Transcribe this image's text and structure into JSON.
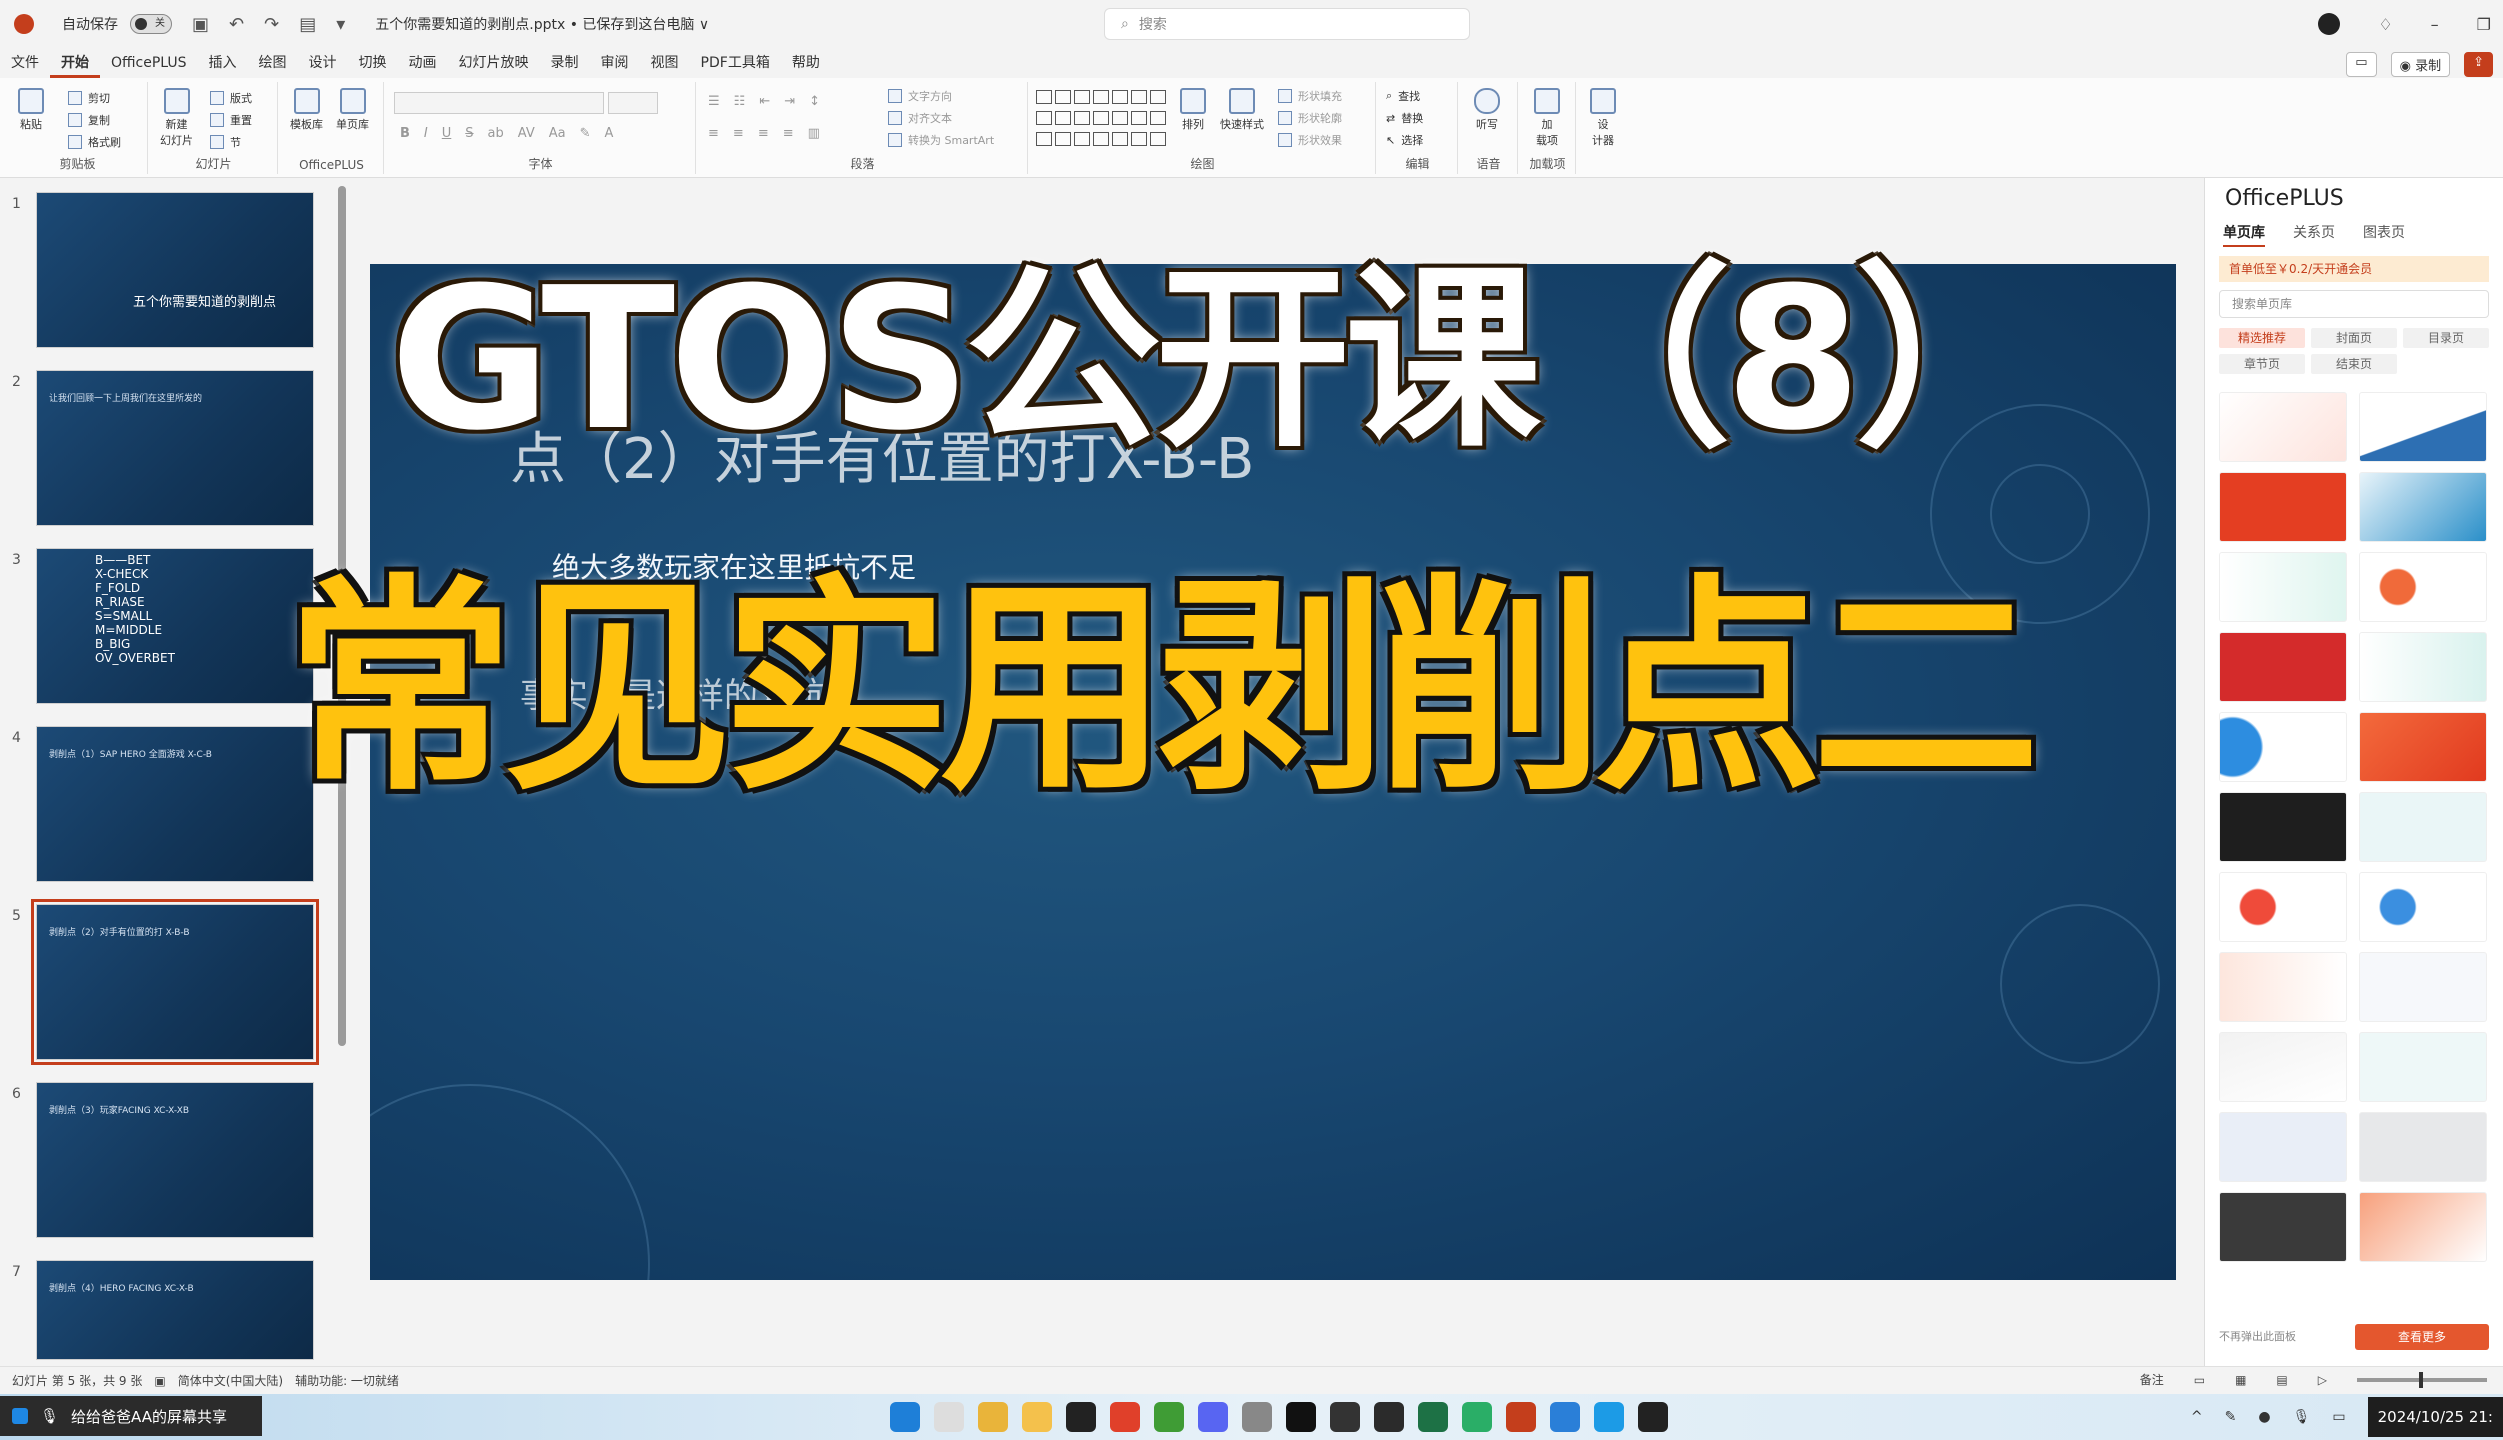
{
  "titlebar": {
    "autosave_label": "自动保存",
    "autosave_state": "关",
    "filename": "五个你需要知道的剥削点.pptx • 已保存到这台电脑 ∨",
    "search_placeholder": "搜索"
  },
  "menu": {
    "tabs": [
      "文件",
      "开始",
      "OfficePLUS",
      "插入",
      "绘图",
      "设计",
      "切换",
      "动画",
      "幻灯片放映",
      "录制",
      "审阅",
      "视图",
      "PDF工具箱",
      "帮助"
    ],
    "active": "开始",
    "record_label": "录制"
  },
  "ribbon": {
    "clipboard": {
      "paste": "粘贴",
      "cut": "剪切",
      "copy": "复制",
      "format_painter": "格式刷",
      "label": "剪贴板"
    },
    "slides": {
      "new_slide": "新建\n幻灯片",
      "layout": "版式",
      "reset": "重置",
      "section": "节",
      "label": "幻灯片"
    },
    "officeplus": {
      "template": "模板库",
      "single": "单页库",
      "label": "OfficePLUS"
    },
    "font": {
      "label": "字体"
    },
    "paragraph": {
      "text_direction": "文字方向",
      "align_text": "对齐文本",
      "smartart": "转换为 SmartArt",
      "label": "段落"
    },
    "drawing": {
      "arrange": "排列",
      "quick_styles": "快速样式",
      "shape_fill": "形状填充",
      "shape_outline": "形状轮廓",
      "shape_effects": "形状效果",
      "label": "绘图"
    },
    "editing": {
      "find": "查找",
      "replace": "替换",
      "select": "选择",
      "label": "编辑"
    },
    "voice": {
      "dictate": "听写",
      "label": "语音"
    },
    "addins": {
      "addins": "加\n载项",
      "label": "加载项"
    },
    "designer": {
      "designer": "设\n计器"
    }
  },
  "thumbnails": [
    {
      "num": "1",
      "title": "五个你需要知道的剥削点"
    },
    {
      "num": "2",
      "title": "让我们回顾一下上周我们在这里所发的"
    },
    {
      "num": "3",
      "list": "B——BET\nX-CHECK\nF_FOLD\nR_RIASE\nS=SMALL\nM=MIDDLE\nB_BIG\nOV_OVERBET"
    },
    {
      "num": "4",
      "title": "剥削点（1）SAP HERO 全面游戏 X-C-B"
    },
    {
      "num": "5",
      "title": "剥削点（2）对手有位置的打 X-B-B"
    },
    {
      "num": "6",
      "title": "剥削点（3）玩家FACING XC-X-XB"
    },
    {
      "num": "7",
      "title": "剥削点（4）HERO FACING XC-X-B"
    }
  ],
  "slide": {
    "ghost_title": "点（2）对手有位置的打X-B-B",
    "subtitle": "绝大多数玩家在这里抵抗不足",
    "ghost_line2": "事实上是这样的对抗"
  },
  "overlay": {
    "line1": "GTOS公开课（8）",
    "line2": "常见实用剥削点二"
  },
  "pane": {
    "title": "OfficePLUS",
    "tabs": [
      "单页库",
      "关系页",
      "图表页"
    ],
    "banner": "首单低至￥0.2/天开通会员",
    "search_placeholder": "搜索单页库",
    "chips": [
      "精选推荐",
      "封面页",
      "目录页",
      "章节页",
      "结束页"
    ],
    "footer": "不再弹出此面板",
    "more": "查看更多"
  },
  "status": {
    "slide_info": "幻灯片 第 5 张，共 9 张",
    "language": "简体中文(中国大陆)",
    "accessibility": "辅助功能: 一切就绪",
    "notes": "备注"
  },
  "taskbar": {
    "share_label": "给给爸爸AA的屏幕共享",
    "clock": "2024/10/25 21:"
  },
  "colors": {
    "accent": "#c43e1c",
    "slide_bg": "#184770",
    "overlay_yellow": "#ffc20e"
  }
}
